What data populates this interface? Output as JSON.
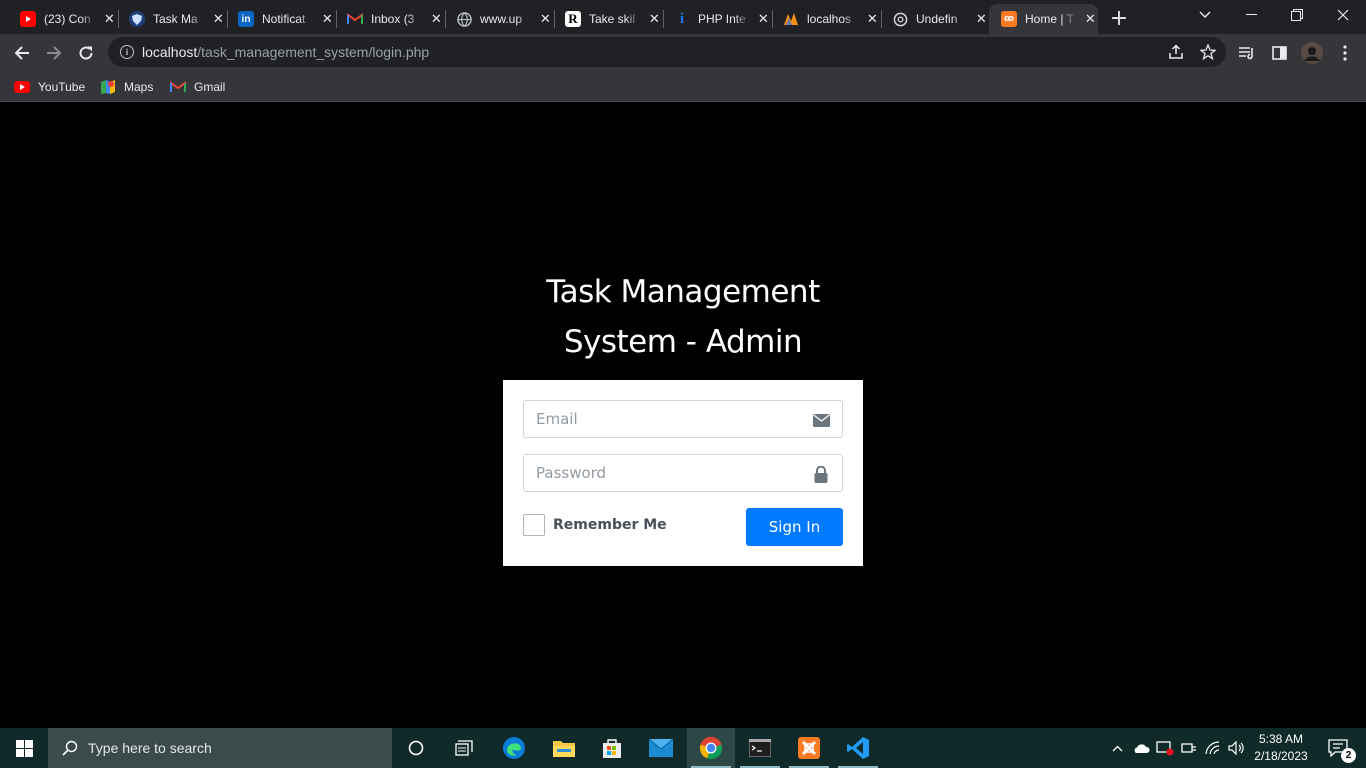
{
  "browser": {
    "tabs": [
      {
        "title": "(23) Con",
        "favicon": "youtube-icon",
        "color": "#ff0000"
      },
      {
        "title": "Task Ma",
        "favicon": "shield-icon",
        "color": "#1f6feb"
      },
      {
        "title": "Notificat",
        "favicon": "linkedin-icon",
        "color": "#0a66c2"
      },
      {
        "title": "Inbox (3",
        "favicon": "gmail-icon",
        "color": "#ea4335"
      },
      {
        "title": "www.up",
        "favicon": "globe-icon",
        "color": "#bdc1c6"
      },
      {
        "title": "Take skil",
        "favicon": "r-icon",
        "color": "#ffffff"
      },
      {
        "title": "PHP Inte",
        "favicon": "info-icon",
        "color": "#1a73e8"
      },
      {
        "title": "localhos",
        "favicon": "phpmyadmin-icon",
        "color": "#f29111"
      },
      {
        "title": "Undefin",
        "favicon": "openai-icon",
        "color": "#10a37f"
      },
      {
        "title": "Home | T",
        "favicon": "xampp-icon",
        "color": "#fb7a24"
      }
    ],
    "active_tab_index": 9,
    "url_host": "localhost",
    "url_path": "/task_management_system/login.php",
    "bookmarks": [
      {
        "label": "YouTube",
        "icon": "youtube-icon"
      },
      {
        "label": "Maps",
        "icon": "maps-icon"
      },
      {
        "label": "Gmail",
        "icon": "gmail-icon"
      }
    ]
  },
  "login": {
    "title_line1": "Task Management",
    "title_line2": "System - Admin",
    "email_placeholder": "Email",
    "email_value": "",
    "password_placeholder": "Password",
    "password_value": "",
    "remember_label": "Remember Me",
    "remember_checked": false,
    "signin_label": "Sign In",
    "accent_color": "#007bff"
  },
  "taskbar": {
    "search_placeholder": "Type here to search",
    "apps": [
      "cortana-icon",
      "task-view-icon",
      "edge-icon",
      "file-explorer-icon",
      "microsoft-store-icon",
      "mail-icon",
      "chrome-icon",
      "terminal-icon",
      "xampp-icon",
      "vscode-icon"
    ],
    "time": "5:38 AM",
    "date": "2/18/2023",
    "notification_count": "2"
  }
}
